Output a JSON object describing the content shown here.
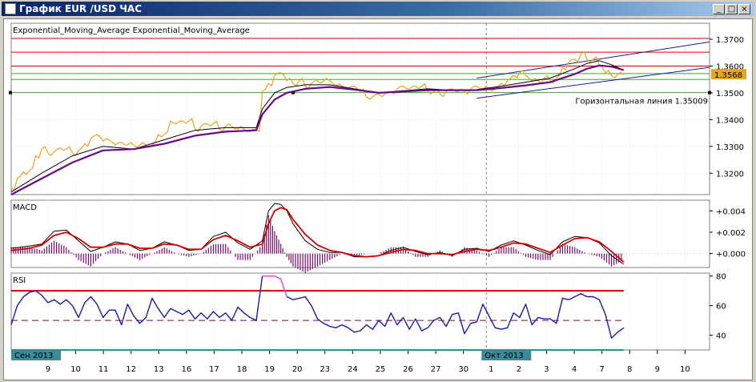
{
  "window": {
    "title": "График EUR /USD  ЧАС",
    "buttons": {
      "minimize": "_",
      "maximize": "□",
      "close": "×"
    }
  },
  "colors": {
    "price": "#e6a51e",
    "ema_fast": "#000000",
    "ema_slow": "#6b0a86",
    "level_red": "#d40000",
    "level_green": "#3aa82e",
    "channel": "#1b1b9a",
    "macd_line": "#000000",
    "macd_signal": "#d40000",
    "macd_hist": "#7a0a6a",
    "rsi": "#1a1aa8",
    "rsi_overbought": "#e040e0",
    "rsi_upper": "#d40000",
    "rsi_mid": "#6b0a45",
    "rsi_lower": "#1a9a8a",
    "price_tag_bg": "#e6a51e"
  },
  "chart_data": [
    {
      "type": "line",
      "title": "Exponential_Moving_Average Exponential_Moving_Average",
      "x_tick_labels": [
        "9",
        "10",
        "11",
        "12",
        "13",
        "16",
        "17",
        "18",
        "19",
        "20",
        "23",
        "24",
        "25",
        "26",
        "27",
        "30",
        "1",
        "2",
        "3",
        "4",
        "7",
        "8",
        "9",
        "10"
      ],
      "month_labels": [
        "Сен 2013",
        "Окт 2013"
      ],
      "ylim": [
        1.312,
        1.376
      ],
      "y_ticks": [
        "1.3700",
        "1.3600",
        "1.3500",
        "1.3400",
        "1.3300",
        "1.3200"
      ],
      "current_price_label": "1.3568",
      "current_price": 1.3568,
      "horizontal_line_label": "Горизонтальная линия 1.35009",
      "horizontal_line_value": 1.35009,
      "red_levels": [
        1.3703,
        1.3652,
        1.36
      ],
      "green_levels": [
        1.3572,
        1.355,
        1.35009
      ],
      "series": [
        {
          "role": "price",
          "x": [
            0,
            1,
            2,
            3,
            4,
            5,
            6,
            7,
            8,
            9,
            10,
            11,
            12,
            13,
            14,
            15,
            16,
            17,
            18,
            19,
            20,
            21,
            22,
            23,
            24,
            25,
            26,
            27,
            28,
            29,
            30,
            31,
            32,
            33,
            34,
            35,
            36,
            37,
            38,
            39,
            40,
            41,
            42,
            43,
            44,
            45,
            46,
            47,
            48,
            49,
            50,
            51,
            52,
            53,
            54,
            55,
            56,
            57,
            58,
            59,
            60,
            61,
            62,
            63,
            64,
            65,
            66,
            67,
            68,
            69,
            70,
            71,
            72,
            73,
            74,
            75,
            76,
            77,
            78,
            79,
            80,
            81,
            82,
            83,
            84,
            85,
            86,
            87,
            88,
            89,
            90,
            91,
            92,
            93,
            94,
            95,
            96,
            97,
            98,
            99,
            100
          ],
          "y": [
            1.3145,
            1.318,
            1.3205,
            1.321,
            1.3265,
            1.329,
            1.3275,
            1.328,
            1.3295,
            1.329,
            1.3275,
            1.3285,
            1.331,
            1.333,
            1.3345,
            1.332,
            1.3325,
            1.3305,
            1.3315,
            1.3305,
            1.3305,
            1.3305,
            1.3305,
            1.3305,
            1.3345,
            1.3345,
            1.3395,
            1.3385,
            1.3395,
            1.3395,
            1.3365,
            1.3375,
            1.3385,
            1.3385,
            1.3365,
            1.3375,
            1.3375,
            1.3365,
            1.3365,
            1.3355,
            1.3365,
            1.3505,
            1.3535,
            1.3565,
            1.3575,
            1.3545,
            1.3535,
            1.3545,
            1.3525,
            1.3535,
            1.3545,
            1.3545,
            1.3545,
            1.3525,
            1.3525,
            1.3515,
            1.3525,
            1.3505,
            1.3485,
            1.3485,
            1.3495,
            1.3495,
            1.3505,
            1.3515,
            1.3525,
            1.3515,
            1.3525,
            1.3525,
            1.3505,
            1.3505,
            1.3495,
            1.3505,
            1.3515,
            1.3505,
            1.3505,
            1.3515,
            1.3525,
            1.3515,
            1.3515,
            1.3515,
            1.3535,
            1.3545,
            1.3565,
            1.3575,
            1.3565,
            1.3545,
            1.3545,
            1.3555,
            1.3545,
            1.3555,
            1.3595,
            1.3615,
            1.3625,
            1.3645,
            1.3625,
            1.3625,
            1.3605,
            1.3575,
            1.3565,
            1.3568,
            1.3568
          ]
        },
        {
          "role": "ema_fast",
          "x": [
            0,
            5,
            10,
            15,
            20,
            25,
            30,
            35,
            40,
            41,
            43,
            45,
            48,
            52,
            56,
            60,
            64,
            68,
            72,
            76,
            80,
            84,
            88,
            92,
            94,
            96,
            98,
            100
          ],
          "y": [
            1.313,
            1.32,
            1.3265,
            1.33,
            1.329,
            1.3325,
            1.336,
            1.337,
            1.337,
            1.344,
            1.35,
            1.352,
            1.353,
            1.353,
            1.3515,
            1.35,
            1.3508,
            1.3515,
            1.351,
            1.3512,
            1.3525,
            1.354,
            1.3555,
            1.359,
            1.361,
            1.362,
            1.3605,
            1.3585
          ]
        },
        {
          "role": "ema_slow",
          "x": [
            0,
            5,
            10,
            15,
            20,
            25,
            30,
            35,
            40,
            41,
            43,
            45,
            48,
            52,
            56,
            60,
            64,
            68,
            72,
            76,
            80,
            84,
            88,
            92,
            94,
            96,
            98,
            100
          ],
          "y": [
            1.312,
            1.318,
            1.324,
            1.3285,
            1.329,
            1.331,
            1.334,
            1.3355,
            1.336,
            1.342,
            1.3475,
            1.35,
            1.3515,
            1.3522,
            1.3512,
            1.35,
            1.3505,
            1.351,
            1.351,
            1.351,
            1.3518,
            1.3528,
            1.354,
            1.357,
            1.359,
            1.3602,
            1.3598,
            1.3585
          ]
        }
      ],
      "channel_lines": [
        {
          "x": [
            76,
            114
          ],
          "y": [
            1.3555,
            1.369
          ]
        },
        {
          "x": [
            76,
            114
          ],
          "y": [
            1.348,
            1.3595
          ]
        }
      ]
    },
    {
      "type": "line",
      "title": "MACD",
      "ylim": [
        -0.0013,
        0.005
      ],
      "y_ticks": [
        "+0.004",
        "+0.002",
        "+0.000"
      ],
      "series": [
        {
          "role": "macd",
          "x": [
            0,
            3,
            5,
            7,
            9,
            11,
            13,
            15,
            17,
            19,
            21,
            23,
            25,
            27,
            29,
            31,
            33,
            35,
            37,
            39,
            41,
            42,
            43,
            44,
            45,
            46,
            48,
            50,
            52,
            54,
            56,
            58,
            60,
            62,
            64,
            66,
            68,
            70,
            72,
            74,
            76,
            78,
            80,
            82,
            84,
            86,
            88,
            90,
            92,
            94,
            96,
            98,
            100
          ],
          "y": [
            0.0005,
            0.0007,
            0.0009,
            0.0021,
            0.0022,
            0.0012,
            0.0002,
            0.0006,
            0.0011,
            0.0009,
            0.0003,
            0.0005,
            0.0011,
            0.0008,
            0.0003,
            0.0004,
            0.0016,
            0.002,
            0.001,
            0.0004,
            0.0012,
            0.004,
            0.0047,
            0.0046,
            0.004,
            0.0028,
            0.0012,
            0.0004,
            0.0001,
            0.0001,
            -0.0003,
            -0.0003,
            -0.0002,
            0.0003,
            0.0006,
            0.0002,
            -0.0001,
            0.0001,
            -0.0002,
            0.0004,
            0.0005,
            0.0002,
            0.0008,
            0.0012,
            0.0008,
            0.0003,
            -0.0001,
            0.0011,
            0.0016,
            0.0015,
            0.001,
            -0.0002,
            -0.001
          ]
        },
        {
          "role": "signal",
          "x": [
            0,
            3,
            5,
            7,
            9,
            11,
            13,
            15,
            17,
            19,
            21,
            23,
            25,
            27,
            29,
            31,
            33,
            35,
            37,
            39,
            41,
            42,
            43,
            44,
            45,
            46,
            48,
            50,
            52,
            54,
            56,
            58,
            60,
            62,
            64,
            66,
            68,
            70,
            72,
            74,
            76,
            78,
            80,
            82,
            84,
            86,
            88,
            90,
            92,
            94,
            96,
            98,
            100
          ],
          "y": [
            0.0003,
            0.0005,
            0.0008,
            0.0017,
            0.002,
            0.0014,
            0.0006,
            0.0006,
            0.0009,
            0.0009,
            0.0005,
            0.0005,
            0.0009,
            0.0008,
            0.0004,
            0.0004,
            0.0013,
            0.0017,
            0.0012,
            0.0006,
            0.0009,
            0.0028,
            0.004,
            0.0043,
            0.0041,
            0.0032,
            0.0018,
            0.0008,
            0.0003,
            0.0001,
            -0.0002,
            -0.0003,
            -0.0002,
            0.0001,
            0.0004,
            0.0003,
            0.0,
            0.0,
            -0.0001,
            0.0002,
            0.0004,
            0.0003,
            0.0006,
            0.001,
            0.0009,
            0.0005,
            0.0001,
            0.0008,
            0.0014,
            0.0015,
            0.0011,
            0.0002,
            -0.0008
          ]
        }
      ]
    },
    {
      "type": "line",
      "title": "RSI",
      "ylim": [
        30,
        82
      ],
      "y_ticks": [
        "80",
        "60",
        "40"
      ],
      "levels": [
        70,
        50,
        30
      ],
      "series": [
        {
          "role": "rsi",
          "x": [
            0,
            1,
            2,
            3,
            4,
            5,
            6,
            7,
            8,
            9,
            10,
            11,
            12,
            13,
            14,
            15,
            16,
            17,
            18,
            19,
            20,
            21,
            22,
            23,
            24,
            25,
            26,
            27,
            28,
            29,
            30,
            31,
            32,
            33,
            34,
            35,
            36,
            37,
            38,
            39,
            40,
            41,
            42,
            43,
            44,
            45,
            46,
            47,
            48,
            49,
            50,
            51,
            52,
            53,
            54,
            55,
            56,
            57,
            58,
            59,
            60,
            61,
            62,
            63,
            64,
            65,
            66,
            67,
            68,
            69,
            70,
            71,
            72,
            73,
            74,
            75,
            76,
            77,
            78,
            79,
            80,
            81,
            82,
            83,
            84,
            85,
            86,
            87,
            88,
            89,
            90,
            91,
            92,
            93,
            94,
            95,
            96,
            97,
            98,
            99,
            100
          ],
          "y": [
            47,
            60,
            66,
            69,
            70,
            67,
            62,
            64,
            61,
            64,
            60,
            52,
            62,
            66,
            61,
            52,
            57,
            57,
            47,
            61,
            53,
            48,
            52,
            65,
            58,
            52,
            58,
            56,
            54,
            57,
            51,
            55,
            51,
            56,
            52,
            55,
            50,
            59,
            55,
            52,
            50,
            80,
            80,
            80,
            78,
            66,
            64,
            65,
            66,
            60,
            51,
            48,
            46,
            45,
            47,
            45,
            42,
            43,
            47,
            44,
            50,
            46,
            55,
            47,
            52,
            44,
            51,
            43,
            45,
            50,
            52,
            46,
            54,
            55,
            41,
            48,
            49,
            61,
            53,
            45,
            44,
            45,
            55,
            52,
            61,
            47,
            52,
            51,
            51,
            48,
            65,
            64,
            66,
            68,
            66,
            66,
            64,
            54,
            38,
            42,
            45
          ]
        }
      ]
    }
  ]
}
